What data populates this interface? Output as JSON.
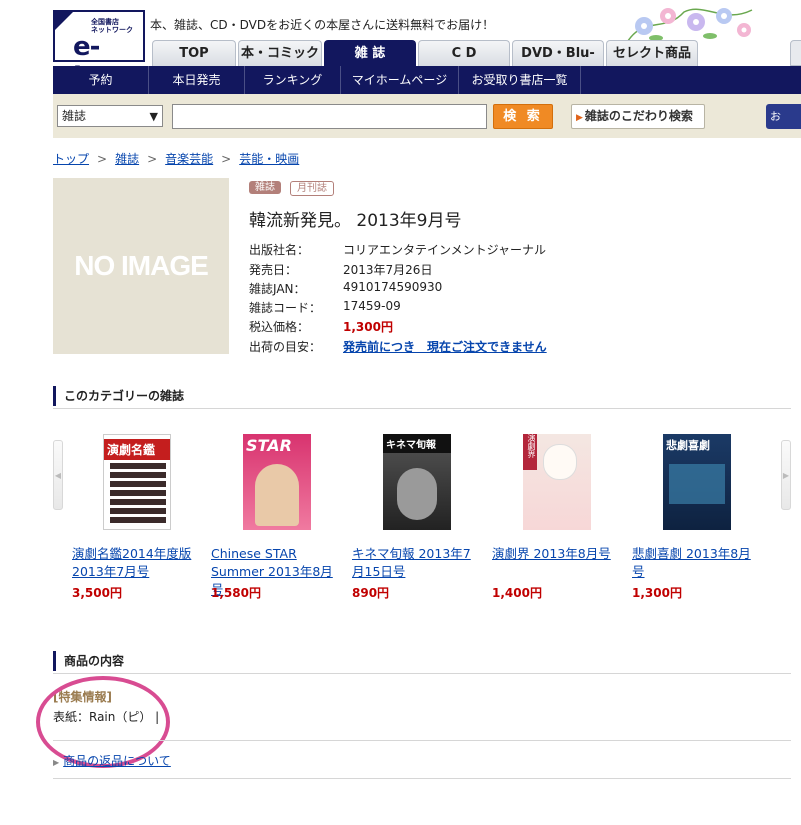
{
  "header": {
    "logo_sub": "全国書店\nネットワーク",
    "logo_main": "e-hon",
    "tagline": "本、雑誌、CD・DVDをお近くの本屋さんに送料無料でお届け！"
  },
  "tabs": [
    {
      "label": "TOP",
      "active": false
    },
    {
      "label": "本・コミック",
      "active": false
    },
    {
      "label": "雑 誌",
      "active": true
    },
    {
      "label": "C D",
      "active": false
    },
    {
      "label": "DVD・Blu-ray",
      "active": false
    },
    {
      "label": "セレクト商品",
      "active": false
    }
  ],
  "nav": [
    "予約",
    "本日発売",
    "ランキング",
    "マイホームページ",
    "お受取り書店一覧"
  ],
  "search": {
    "category": "雑誌",
    "query": "",
    "button": "検 索",
    "advanced": "雑誌のこだわり検索",
    "right_button": "お"
  },
  "breadcrumb": [
    "トップ",
    "雑誌",
    "音楽芸能",
    "芸能・映画"
  ],
  "product": {
    "image_text": "NO IMAGE",
    "badges": [
      "雑誌",
      "月刊誌"
    ],
    "title": "韓流新発見。 2013年9月号",
    "specs": [
      {
        "label": "出版社名：",
        "value": "コリアエンタテインメントジャーナル"
      },
      {
        "label": "発売日：",
        "value": "2013年7月26日"
      },
      {
        "label": "雑誌JAN：",
        "value": "4910174590930"
      },
      {
        "label": "雑誌コード：",
        "value": "17459-09"
      },
      {
        "label": "税込価格：",
        "value": "1,300円"
      },
      {
        "label": "出荷の目安：",
        "value": "発売前につき　現在ご注文できません"
      }
    ]
  },
  "category_section": {
    "heading": "このカテゴリーの雑誌",
    "items": [
      {
        "title": "演劇名鑑2014年度版 2013年7月号",
        "price": "3,500円",
        "cover_text": "演劇名鑑"
      },
      {
        "title": "Chinese STAR Summer 2013年8月号",
        "price": "1,580円",
        "cover_text": "STAR"
      },
      {
        "title": "キネマ旬報 2013年7月15日号",
        "price": "890円",
        "cover_text": "キネマ旬報"
      },
      {
        "title": "演劇界 2013年8月号",
        "price": "1,400円",
        "cover_text": "演劇界"
      },
      {
        "title": "悲劇喜劇 2013年8月号",
        "price": "1,300円",
        "cover_text": "悲劇喜劇"
      }
    ]
  },
  "contents_section": {
    "heading": "商品の内容",
    "feature_label": "[特集情報]",
    "feature_text": "表紙：Rain（ピ） |",
    "return_link": "商品の返品について"
  },
  "colors": {
    "navy": "#12175e",
    "search_bg": "#ece8d8",
    "price_red": "#c00000",
    "highlight_ellipse": "#d84c92"
  }
}
